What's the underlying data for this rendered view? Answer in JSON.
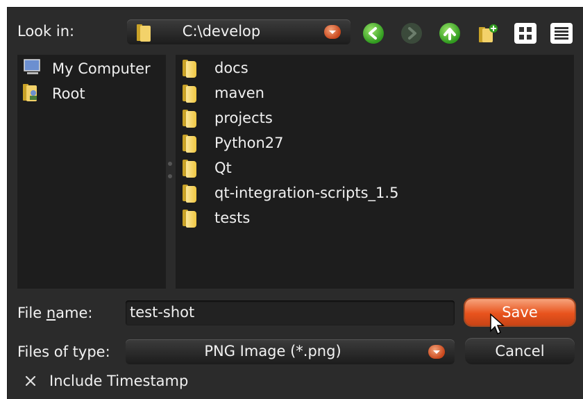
{
  "toolbar": {
    "look_in_label": "Look in:",
    "path": "C:\\develop",
    "icons": [
      "back-icon",
      "forward-icon",
      "up-icon",
      "new-folder-icon",
      "list-view-icon",
      "detail-view-icon"
    ]
  },
  "sidebar": {
    "items": [
      {
        "label": "My Computer",
        "icon": "computer-icon"
      },
      {
        "label": "Root",
        "icon": "user-folder-icon"
      }
    ]
  },
  "files": {
    "items": [
      {
        "name": "docs"
      },
      {
        "name": "maven"
      },
      {
        "name": "projects"
      },
      {
        "name": "Python27"
      },
      {
        "name": "Qt"
      },
      {
        "name": "qt-integration-scripts_1.5"
      },
      {
        "name": "tests"
      }
    ]
  },
  "form": {
    "file_name_label": "File name:",
    "file_name_value": "test-shot",
    "file_type_label": "Files of type:",
    "file_type_value": "PNG Image (*.png)",
    "save_label": "Save",
    "cancel_label": "Cancel",
    "timestamp_label": "Include Timestamp",
    "timestamp_checked": true
  },
  "colors": {
    "background": "#2b2b2b",
    "pane": "#1d1d1d",
    "accent": "#e8531d",
    "folder": "#f0c640"
  }
}
